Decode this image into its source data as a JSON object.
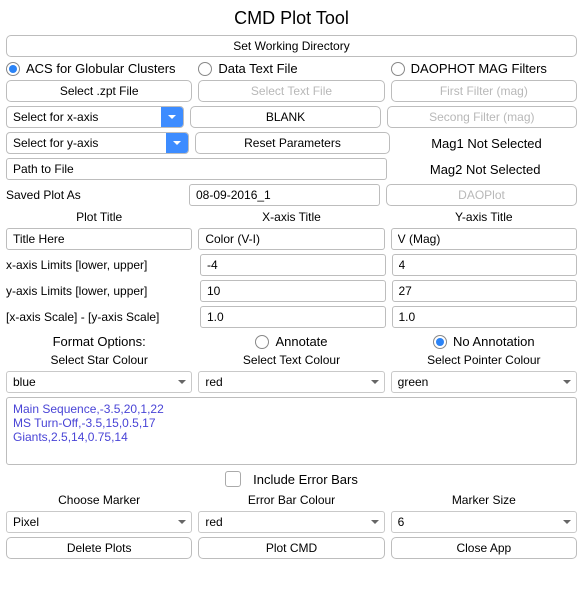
{
  "title": "CMD Plot Tool",
  "set_wd": "Set Working Directory",
  "source": {
    "acs": "ACS for Globular Clusters",
    "textfile": "Data Text File",
    "daophot": "DAOPHOT MAG Filters"
  },
  "buttons_row2": {
    "select_zpt": "Select .zpt File",
    "select_text": "Select Text File",
    "first_filter": "First Filter (mag)"
  },
  "row3": {
    "x_select": "Select for x-axis",
    "blank": "BLANK",
    "second_filter": "Secong Filter (mag)"
  },
  "row4": {
    "y_select": "Select for y-axis",
    "reset": "Reset Parameters",
    "mag1": "Mag1 Not Selected"
  },
  "row5": {
    "path": "Path to File",
    "mag2": "Mag2 Not Selected"
  },
  "row6": {
    "saved_as_lbl": "Saved Plot As",
    "saved_as_val": "08-09-2016_1",
    "daoplot": "DAOPlot"
  },
  "titles_hdr": {
    "plot": "Plot Title",
    "x": "X-axis Title",
    "y": "Y-axis Title"
  },
  "titles_val": {
    "plot": "Title Here",
    "x": "Color (V-I)",
    "y": "V (Mag)"
  },
  "xlim": {
    "lbl": "x-axis Limits [lower, upper]",
    "lo": "-4",
    "hi": "4"
  },
  "ylim": {
    "lbl": "y-axis Limits [lower, upper]",
    "lo": "10",
    "hi": "27"
  },
  "scale": {
    "lbl": "[x-axis Scale] - [y-axis Scale]",
    "x": "1.0",
    "y": "1.0"
  },
  "format_hdr": "Format Options:",
  "annotate": {
    "on": "Annotate",
    "off": "No Annotation"
  },
  "colour_hdr": {
    "star": "Select Star Colour",
    "text": "Select Text Colour",
    "pointer": "Select Pointer Colour"
  },
  "colour_val": {
    "star": "blue",
    "text": "red",
    "pointer": "green"
  },
  "regions_text": "Main Sequence,-3.5,20,1,22\nMS Turn-Off,-3.5,15,0.5,17\nGiants,2.5,14,0.75,14",
  "include_err": "Include Error Bars",
  "bottom_hdr": {
    "marker": "Choose Marker",
    "errcol": "Error Bar Colour",
    "msize": "Marker Size"
  },
  "bottom_val": {
    "marker": "Pixel",
    "errcol": "red",
    "msize": "6"
  },
  "final": {
    "delete": "Delete Plots",
    "plot": "Plot CMD",
    "close": "Close App"
  }
}
